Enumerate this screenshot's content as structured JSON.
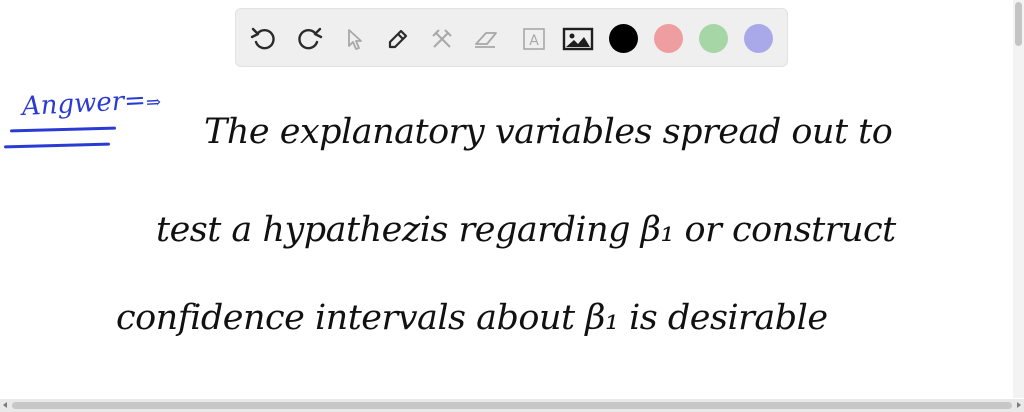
{
  "toolbar": {
    "tools": [
      {
        "name": "undo-icon",
        "label": "Undo"
      },
      {
        "name": "redo-icon",
        "label": "Redo"
      },
      {
        "name": "pointer-icon",
        "label": "Select"
      },
      {
        "name": "pen-icon",
        "label": "Pen"
      },
      {
        "name": "tools-icon",
        "label": "Tools"
      },
      {
        "name": "eraser-icon",
        "label": "Eraser"
      },
      {
        "name": "text-box-icon",
        "label": "Text",
        "glyph": "A"
      },
      {
        "name": "image-icon",
        "label": "Image"
      }
    ],
    "colors": [
      "#000000",
      "#ee9ea1",
      "#a6d5a6",
      "#a9a9ea"
    ]
  },
  "canvas": {
    "answer_label": "Angwer=",
    "answer_arrow": "⇒",
    "lines": [
      "The   explanatory   variables   spread   out to",
      "test   a  hypathezis   regarding   β₁   or  construct",
      "confidence    intervals   about   β₁   is   desirable"
    ]
  }
}
